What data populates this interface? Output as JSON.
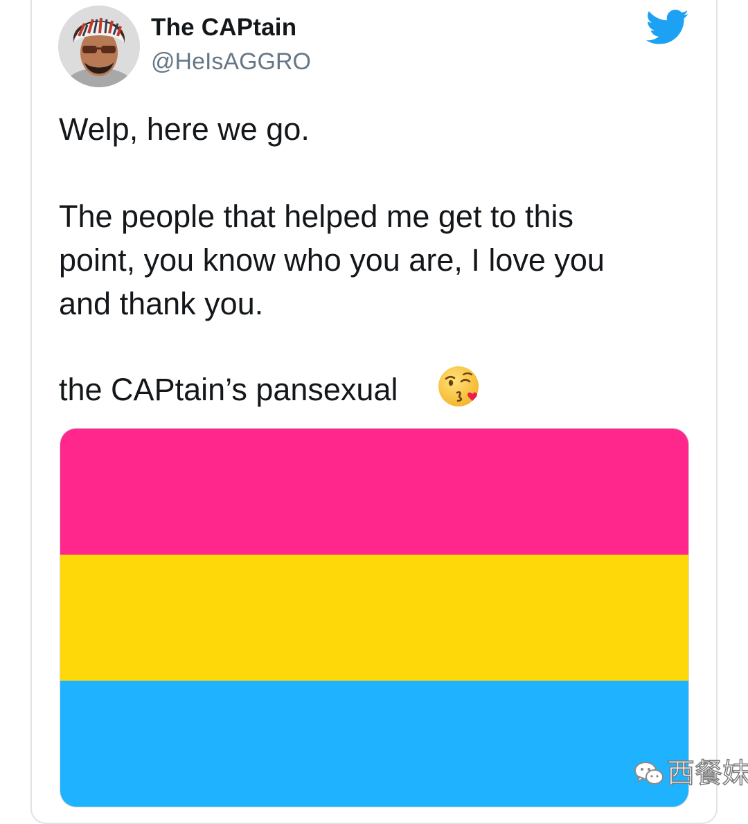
{
  "tweet": {
    "author": {
      "display_name": "The CAPtain",
      "handle": "@HeIsAGGRO"
    },
    "text_lines": [
      "Welp, here we go.",
      "The people that helped me get to this",
      "point, you know who you are, I love you",
      "and thank you.",
      "the CAPtain’s pansexual"
    ],
    "emoji": "face-blowing-a-kiss-icon",
    "media": {
      "stripes": [
        "#ff268c",
        "#ffd80a",
        "#1fb2ff"
      ]
    }
  },
  "brand_icon": "twitter-bird-icon",
  "brand_color": "#1da1f2",
  "watermark": {
    "icon": "wechat-icon",
    "text": "西餐妹"
  }
}
